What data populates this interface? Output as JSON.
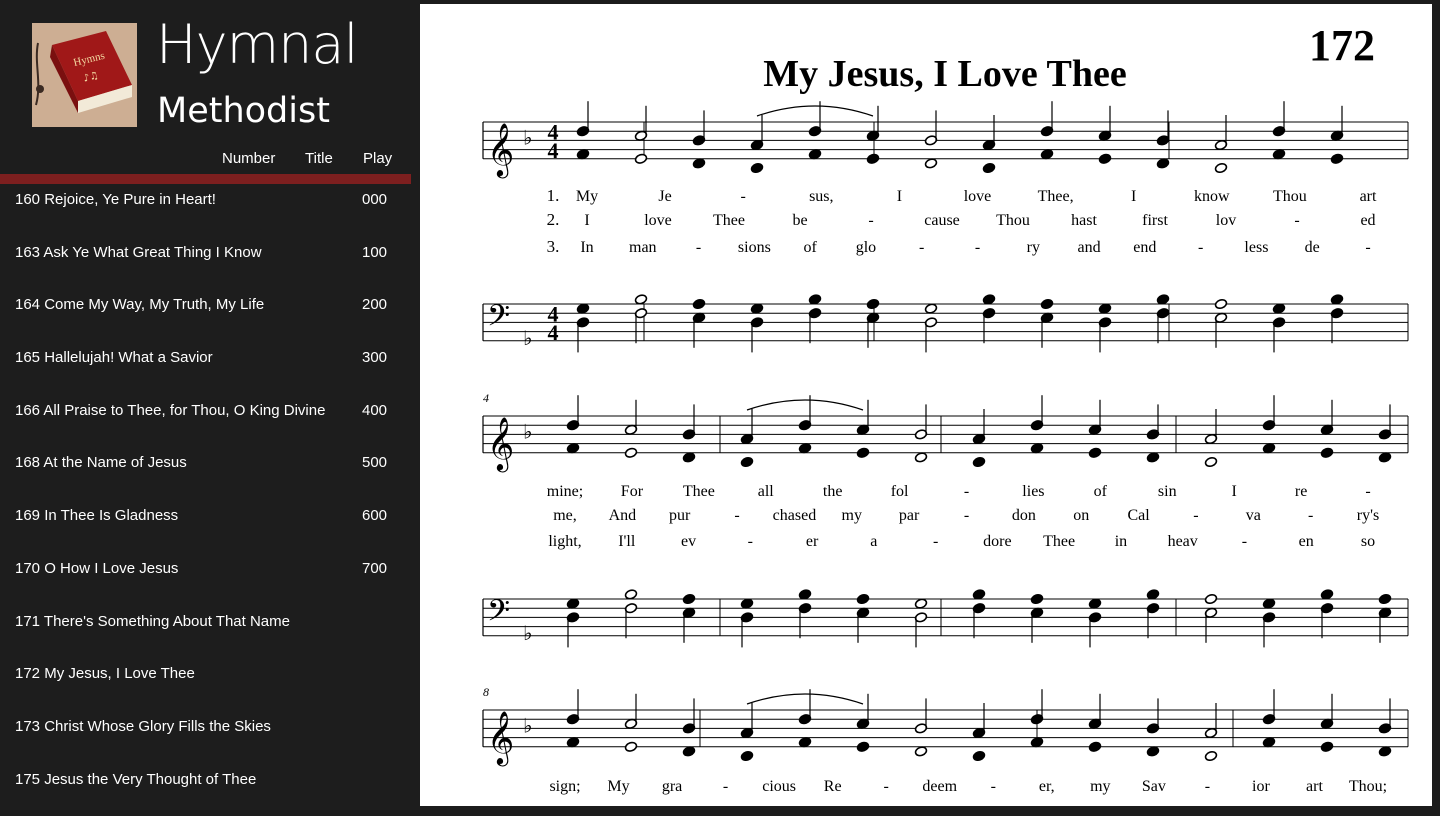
{
  "app": {
    "logo_book_text": "Hymns",
    "title": "Hymnal",
    "subtitle": "Methodist"
  },
  "list_header": {
    "number": "Number",
    "title": "Title",
    "play": "Play"
  },
  "hymns": [
    {
      "title": "160 Rejoice, Ye Pure in Heart!",
      "play": "000"
    },
    {
      "title": "163 Ask Ye What Great Thing I Know",
      "play": "100"
    },
    {
      "title": "164 Come My Way, My Truth, My Life",
      "play": "200"
    },
    {
      "title": "165 Hallelujah! What a Savior",
      "play": "300"
    },
    {
      "title": "166 All Praise to Thee, for Thou, O King Divine",
      "play": "400"
    },
    {
      "title": "168 At the Name of Jesus",
      "play": "500"
    },
    {
      "title": "169 In Thee Is Gladness",
      "play": "600"
    },
    {
      "title": "170 O How I Love Jesus",
      "play": "700"
    },
    {
      "title": "171 There's Something About That Name",
      "play": ""
    },
    {
      "title": "172 My Jesus, I Love Thee",
      "play": ""
    },
    {
      "title": "173 Christ Whose Glory Fills the Skies",
      "play": ""
    },
    {
      "title": "175 Jesus the Very Thought of Thee",
      "play": ""
    }
  ],
  "sheet": {
    "hymn_number": "172",
    "hymn_title": "My Jesus, I Love Thee",
    "time_signature": [
      "4",
      "4"
    ],
    "systems": [
      {
        "measure_number": "",
        "verses": [
          {
            "num": "1.",
            "words": [
              "My",
              "Je",
              "-",
              "sus,",
              "I",
              "love",
              "Thee,",
              "I",
              "know",
              "Thou",
              "art"
            ]
          },
          {
            "num": "2.",
            "words": [
              "I",
              "love",
              "Thee",
              "be",
              "-",
              "cause",
              "Thou",
              "hast",
              "first",
              "lov",
              "-",
              "ed"
            ]
          },
          {
            "num": "3.",
            "words": [
              "In",
              "man",
              "-",
              "sions",
              "of",
              "glo",
              "-",
              "-",
              "ry",
              "and",
              "end",
              "-",
              "less",
              "de",
              "-"
            ]
          }
        ]
      },
      {
        "measure_number": "4",
        "verses": [
          {
            "num": "",
            "words": [
              "mine;",
              "For",
              "Thee",
              "all",
              "the",
              "fol",
              "-",
              "lies",
              "of",
              "sin",
              "I",
              "re",
              "-"
            ]
          },
          {
            "num": "",
            "words": [
              "me,",
              "And",
              "pur",
              "-",
              "chased",
              "my",
              "par",
              "-",
              "don",
              "on",
              "Cal",
              "-",
              "va",
              "-",
              "ry's"
            ]
          },
          {
            "num": "",
            "words": [
              "light,",
              "I'll",
              "ev",
              "-",
              "er",
              "a",
              "-",
              "dore",
              "Thee",
              "in",
              "heav",
              "-",
              "en",
              "so"
            ]
          }
        ]
      },
      {
        "measure_number": "8",
        "verses": [
          {
            "num": "",
            "words": [
              "sign;",
              "My",
              "gra",
              "-",
              "cious",
              "Re",
              "-",
              "deem",
              "-",
              "er,",
              "my",
              "Sav",
              "-",
              "ior",
              "art",
              "Thou;"
            ]
          }
        ]
      }
    ]
  },
  "colors": {
    "sidebar": "#1d1d1d",
    "accent": "#7d1f1f",
    "text": "#ffffff",
    "sheet": "#ffffff"
  }
}
